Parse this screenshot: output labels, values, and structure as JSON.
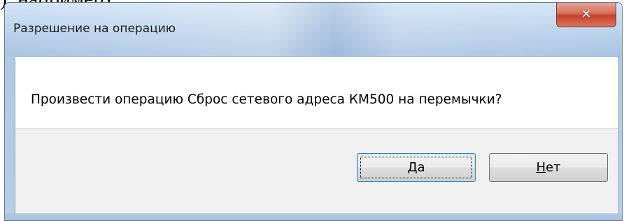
{
  "background_document": {
    "fragment_text": "), например)"
  },
  "dialog": {
    "title": "Разрешение на операцию",
    "message": "Произвести операцию Сброс сетевого адреса КМ500 на перемычки?",
    "close_icon": "close-icon",
    "buttons": {
      "yes": {
        "accel": "Д",
        "rest": "а"
      },
      "no": {
        "accel": "Н",
        "rest": "ет"
      }
    }
  },
  "colors": {
    "close_button": "#c4412c",
    "frame": "#b9d0e8",
    "button_bar": "#f0f0f0",
    "default_button_border": "#3c7fb1"
  }
}
